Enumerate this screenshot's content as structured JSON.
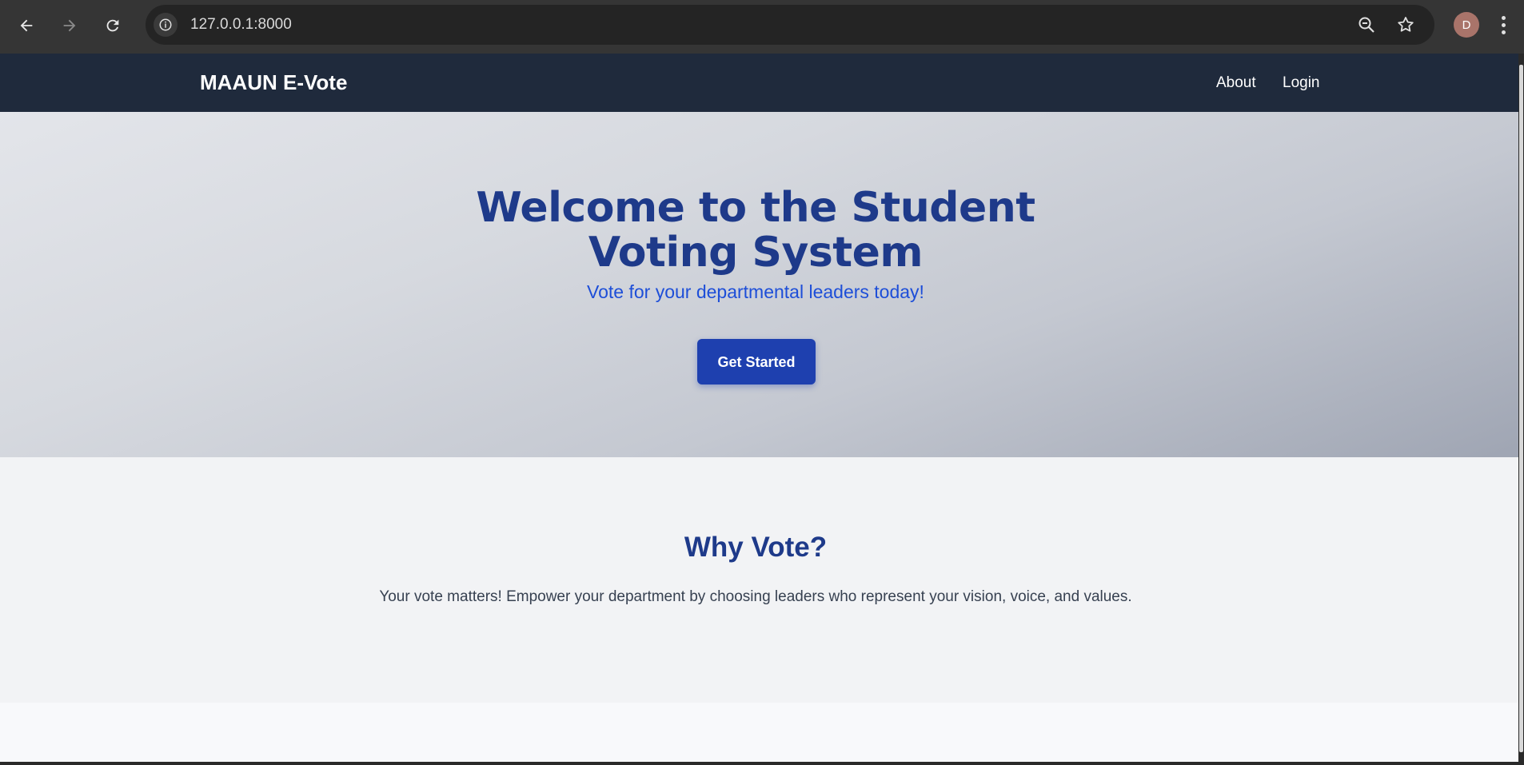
{
  "browser": {
    "url": "127.0.0.1:8000",
    "profile_initial": "D",
    "icons": {
      "back": "arrow-left-icon",
      "forward": "arrow-right-icon",
      "reload": "reload-icon",
      "site_info": "info-icon",
      "zoom": "zoom-out-icon",
      "bookmark": "star-icon",
      "menu": "kebab-menu-icon"
    }
  },
  "nav": {
    "brand": "MAAUN E-Vote",
    "links": [
      "About",
      "Login"
    ]
  },
  "hero": {
    "title_line1": "Welcome to the Student",
    "title_line2": "Voting System",
    "subtitle": "Vote for your departmental leaders today!",
    "cta_label": "Get Started"
  },
  "why": {
    "title": "Why Vote?",
    "text": "Your vote matters! Empower your department by choosing leaders who represent your vision, voice, and values."
  },
  "colors": {
    "nav_bg": "#1f2a3c",
    "primary": "#1e3a8a",
    "button": "#1e40af",
    "subtitle": "#1d4ed8"
  }
}
